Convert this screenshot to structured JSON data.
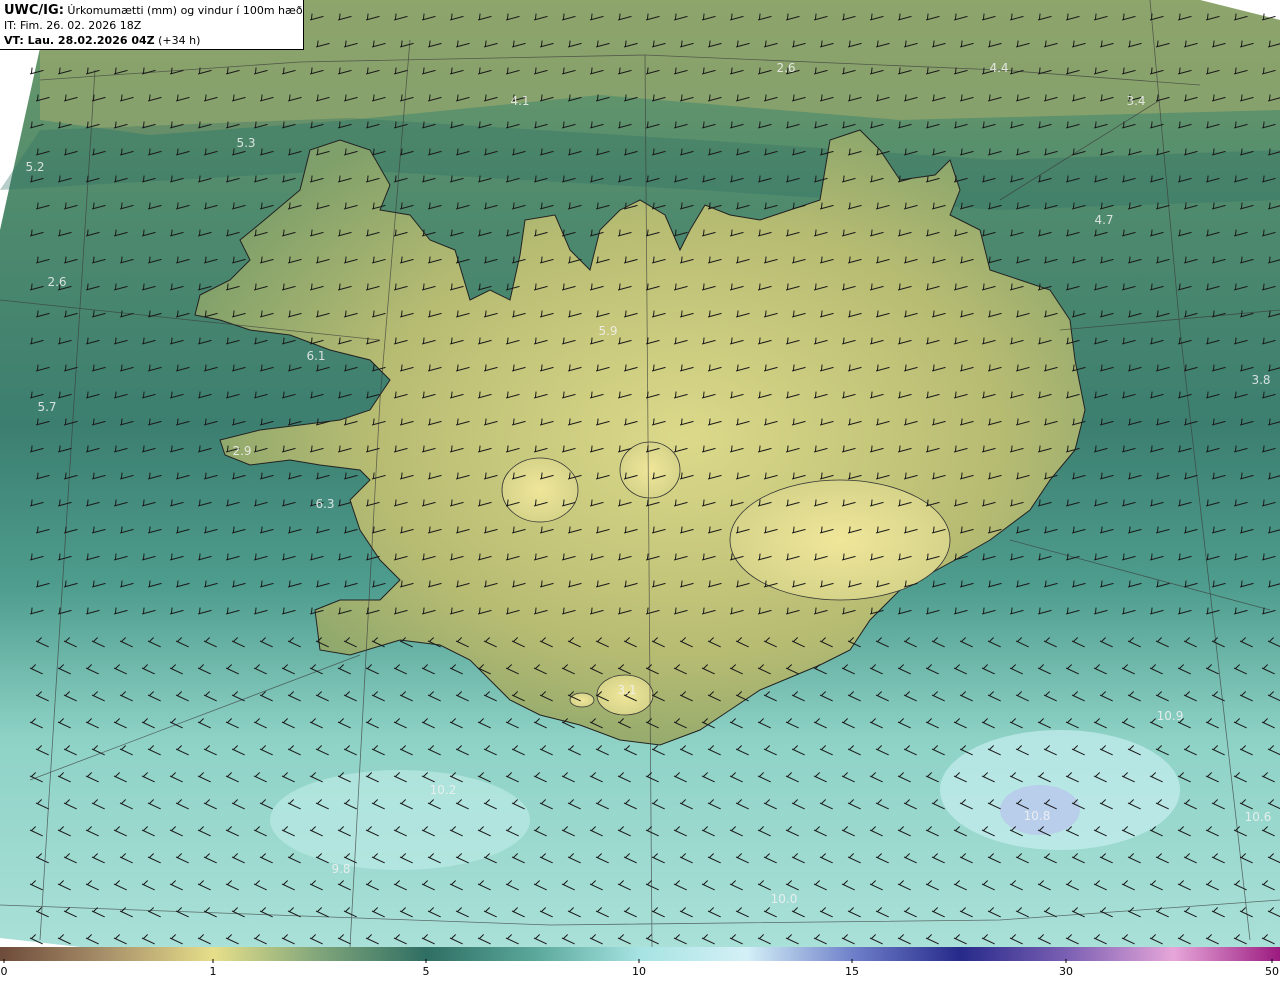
{
  "header": {
    "title_label": "UWC/IG:",
    "title_text": "Úrkomumætti (mm) og vindur í 100m hæð",
    "init_text": "IT: Fim. 26. 02. 2026 18Z",
    "valid_label": "VT: Lau. 28.02.2026 04Z",
    "valid_offset": "(+34 h)"
  },
  "map_labels": [
    {
      "id": "v1",
      "text": "2.6"
    },
    {
      "id": "v2",
      "text": "4.4"
    },
    {
      "id": "v3",
      "text": "4.1"
    },
    {
      "id": "v4",
      "text": "3.4"
    },
    {
      "id": "v5",
      "text": "5.3"
    },
    {
      "id": "v6",
      "text": "5.2"
    },
    {
      "id": "v7",
      "text": "4.7"
    },
    {
      "id": "v8",
      "text": "2.6"
    },
    {
      "id": "v9",
      "text": "5.9"
    },
    {
      "id": "v10",
      "text": "6.1"
    },
    {
      "id": "v11",
      "text": "3.8"
    },
    {
      "id": "v12",
      "text": "5.7"
    },
    {
      "id": "v13",
      "text": "2.9"
    },
    {
      "id": "v14",
      "text": "6.3"
    },
    {
      "id": "v15",
      "text": "3.1"
    },
    {
      "id": "v16",
      "text": "10.2"
    },
    {
      "id": "v17",
      "text": "9.8"
    },
    {
      "id": "v18",
      "text": "10.0"
    },
    {
      "id": "v19",
      "text": "10.9"
    },
    {
      "id": "v20",
      "text": "10.8"
    },
    {
      "id": "v21",
      "text": "10.6"
    }
  ],
  "colorbar": {
    "ticks": [
      "0",
      "1",
      "5",
      "10",
      "15",
      "30",
      "50"
    ],
    "colors": [
      "#6e4b3a",
      "#a8906a",
      "#e6df8a",
      "#7fa57a",
      "#2f6e63",
      "#5aa79a",
      "#a6e3e2",
      "#d4f0f7",
      "#6e7fc9",
      "#262a8a",
      "#7a5fb3",
      "#e6a6d9",
      "#9b1a7f"
    ]
  },
  "style": {
    "ocean": "#3f8a73",
    "land": "#c7c877",
    "south_sea": "#9fdcd3",
    "barb": "#1a1a1a"
  }
}
